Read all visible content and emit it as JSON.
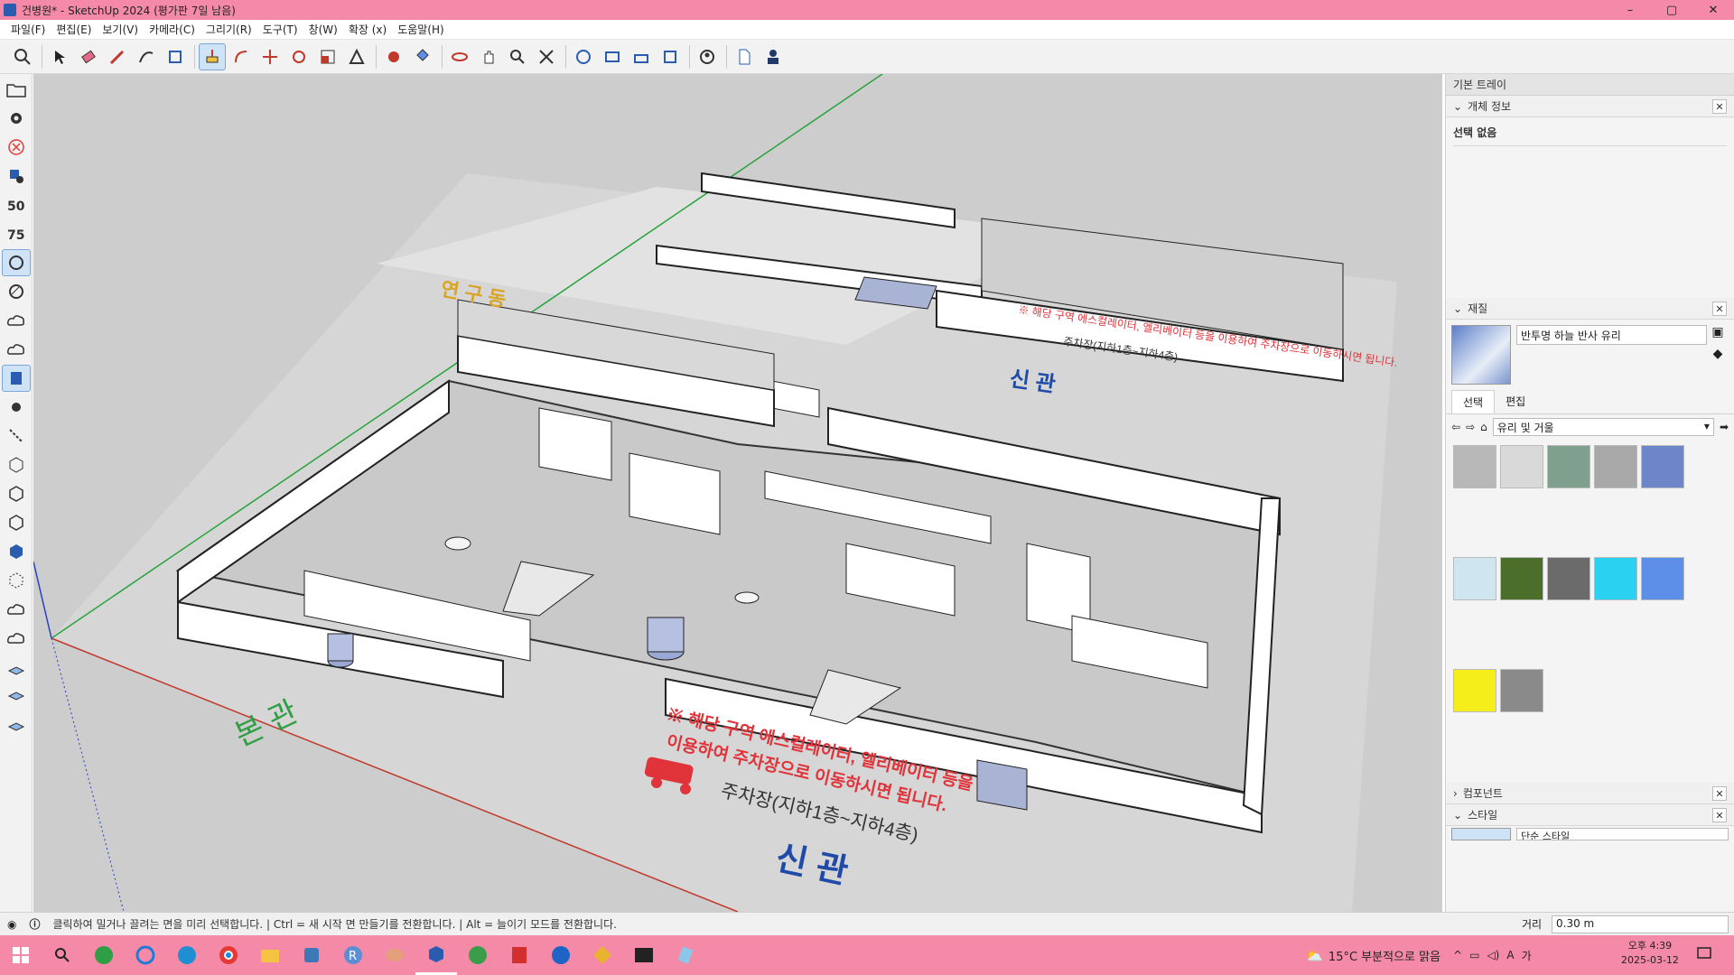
{
  "window": {
    "title": "건병원* - SketchUp 2024 (평가판 7일 남음)",
    "controls": [
      "–",
      "▢",
      "✕"
    ]
  },
  "menu": [
    "파일(F)",
    "편집(E)",
    "보기(V)",
    "카메라(C)",
    "그리기(R)",
    "도구(T)",
    "창(W)",
    "확장 (x)",
    "도움말(H)"
  ],
  "tray": {
    "title": "기본 트레이",
    "entity_info": {
      "header": "개체 정보",
      "selection": "선택 없음"
    },
    "materials": {
      "header": "재질",
      "current_name": "반투명 하늘 반사 유리",
      "tabs": [
        "선택",
        "편집"
      ],
      "library": "유리 및 거울",
      "swatch_colors": [
        "#b8b8b8",
        "#d9d9d9",
        "#7fa08f",
        "#a8a8a8",
        "#6d86c8",
        "#cfe6f1",
        "#4b6f2a",
        "#6b6b6b",
        "#2bd1f0",
        "#5d8ee8",
        "#f5ee1a",
        "#8a8a8a"
      ]
    },
    "components": {
      "header": "컴포넌트"
    },
    "styles": {
      "header": "스타일",
      "current": "단순 스타일"
    }
  },
  "status": {
    "hint": "클릭하여 밀거나 끌려는 면을 미리 선택합니다. | Ctrl = 새 시작 면 만들기를 전환합니다. | Alt = 늘이기 모드를 전환합니다.",
    "measure_label": "거리",
    "measure_value": "0.30 m"
  },
  "scene": {
    "label_bongwan": "본 관",
    "label_singwan_front": "신 관",
    "label_singwan_mid": "신 관",
    "label_yeongudong": "연 구 동",
    "notice_line1": "※ 해당 구역 에스컬레이터, 엘리베이터 등을",
    "notice_line2": "이용하여 주차장으로 이동하시면 됩니다.",
    "parking_text": "주차장(지하1층~지하4층)",
    "notice_far": "※ 해당 구역 에스컬레이터, 엘리베이터 등을 이용하여 주차장으로 이동하시면 됩니다.",
    "parking_far": "주차장(지하1층~지하4층)"
  },
  "taskbar": {
    "weather": "15°C  부분적으로 맑음",
    "time": "오후 4:39",
    "date": "2025-03-12"
  }
}
